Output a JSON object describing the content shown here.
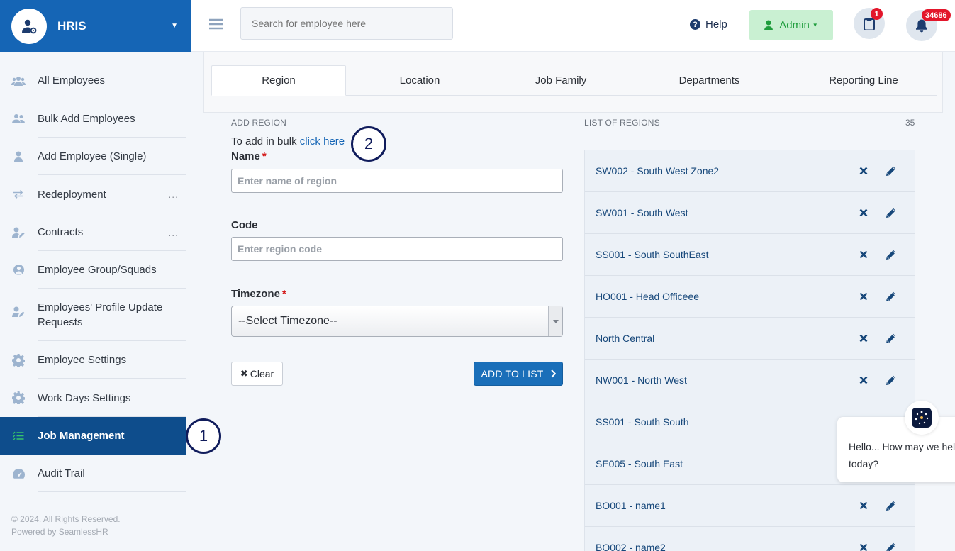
{
  "brand": {
    "name": "HRIS"
  },
  "sidebar": {
    "items": [
      {
        "label": "All Employees",
        "icon": "users-icon",
        "more": ""
      },
      {
        "label": "Bulk Add Employees",
        "icon": "users-icon",
        "more": ""
      },
      {
        "label": "Add Employee (Single)",
        "icon": "user-icon",
        "more": ""
      },
      {
        "label": "Redeployment",
        "icon": "exchange-icon",
        "more": "..."
      },
      {
        "label": "Contracts",
        "icon": "user-edit-icon",
        "more": "..."
      },
      {
        "label": "Employee Group/Squads",
        "icon": "user-circle-icon",
        "more": ""
      },
      {
        "label": "Employees' Profile Update Requests",
        "icon": "user-edit-icon",
        "more": ""
      },
      {
        "label": "Employee Settings",
        "icon": "gear-icon",
        "more": ""
      },
      {
        "label": "Work Days Settings",
        "icon": "gear-icon",
        "more": ""
      },
      {
        "label": "Job Management",
        "icon": "tasks-icon",
        "more": "",
        "active": true
      },
      {
        "label": "Audit Trail",
        "icon": "gauge-icon",
        "more": ""
      }
    ],
    "footer_line1": "© 2024. All Rights Reserved.",
    "footer_line2": "Powered by SeamlessHR"
  },
  "topbar": {
    "search_placeholder": "Search for employee here",
    "help_label": "Help",
    "admin_label": "Admin",
    "tasks_badge": "1",
    "notifications_badge": "34686"
  },
  "tabs": [
    "Region",
    "Location",
    "Job Family",
    "Departments",
    "Reporting Line"
  ],
  "form": {
    "section_title": "ADD REGION",
    "bulk_text": "To add in bulk",
    "bulk_link": "click here",
    "name_label": "Name",
    "name_placeholder": "Enter name of region",
    "code_label": "Code",
    "code_placeholder": "Enter region code",
    "timezone_label": "Timezone",
    "timezone_value": "--Select Timezone--",
    "clear_label": "Clear",
    "add_label": "ADD TO LIST"
  },
  "list": {
    "title": "LIST OF REGIONS",
    "count": "35",
    "items": [
      "SW002 - South West Zone2",
      "SW001 - South West",
      "SS001 - South SouthEast",
      "HO001 - Head Officeee",
      "North Central",
      "NW001 - North West",
      "SS001 - South South",
      "SE005 - South East",
      "BO001 - name1",
      "BO002 - name2"
    ]
  },
  "annotations": [
    "1",
    "2"
  ],
  "chat": {
    "line1": "Hello... How may we hel",
    "line2": "today?"
  },
  "colors": {
    "brand": "#1565b5",
    "active_nav": "#0e4d8c",
    "admin_bg": "#c9f0d2",
    "badge": "#e3162b"
  }
}
